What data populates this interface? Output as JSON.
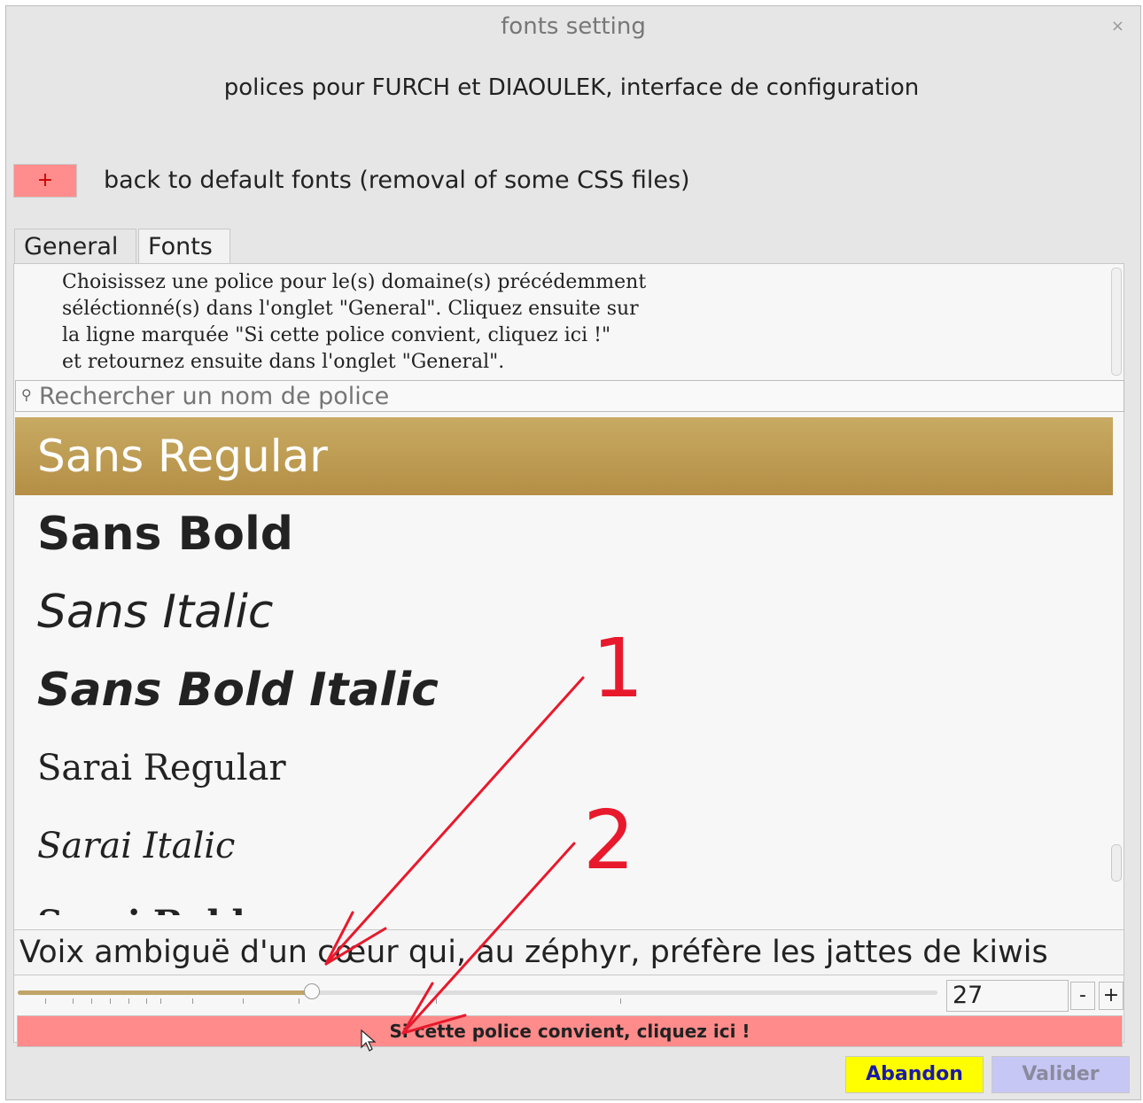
{
  "window": {
    "title": "fonts setting",
    "close_glyph": "×"
  },
  "header": {
    "subtitle": "polices pour FURCH et DIAOULEK, interface de configuration"
  },
  "reset": {
    "button_label": "+",
    "label": "back to default fonts (removal of some CSS files)"
  },
  "tabs": [
    {
      "label": "General"
    },
    {
      "label": "Fonts"
    }
  ],
  "fonts_tab": {
    "instructions": "Choisissez une police pour le(s) domaine(s) précédemment\nséléctionné(s) dans l'onglet \"General\". Cliquez ensuite sur\nla ligne marquée \"Si cette police convient, cliquez ici !\"\net retournez ensuite dans l'onglet \"General\".",
    "search_placeholder": "Rechercher un nom de police",
    "font_list": [
      {
        "name": "Sans Regular",
        "selected": true
      },
      {
        "name": "Sans Bold"
      },
      {
        "name": "Sans Italic"
      },
      {
        "name": "Sans Bold Italic"
      },
      {
        "name": "Sarai  Regular"
      },
      {
        "name": "Sarai  Italic"
      },
      {
        "name": "Sarai  Bold"
      }
    ],
    "preview_text": "Voix ambiguë d'un cœur qui, au zéphyr, préfère les jattes de kiwis",
    "font_size": {
      "value": "27",
      "slider_fraction": 0.32,
      "minus_label": "-",
      "plus_label": "+"
    },
    "confirm_label": "Si cette police convient, cliquez ici !"
  },
  "footer": {
    "abandon_label": "Abandon",
    "valider_label": "Valider"
  },
  "annotations": [
    {
      "label": "1"
    },
    {
      "label": "2"
    }
  ],
  "colors": {
    "selected_row": "#b89548",
    "reset_button": "#ff8d8d",
    "confirm_button": "#ff8b8b",
    "abandon_button": "#ffff00",
    "valider_button": "#c7c7f5",
    "annotation": "#e8192c"
  }
}
